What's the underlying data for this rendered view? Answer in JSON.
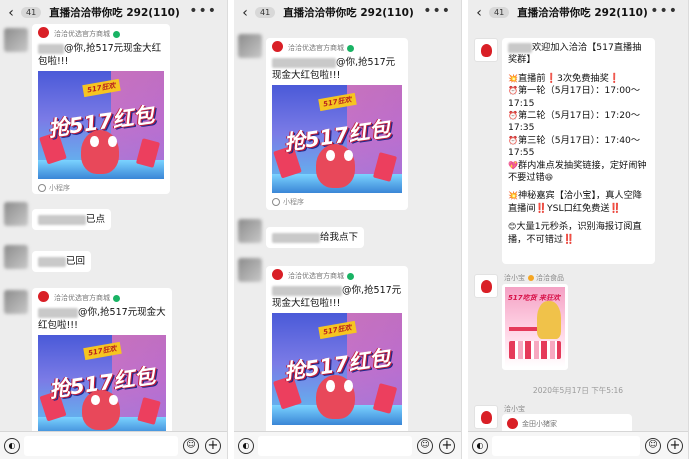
{
  "header": {
    "badge": "41",
    "title": "直播洽洽带你吃 292(110)",
    "back_glyph": "‹",
    "more_glyph": "•••"
  },
  "input_bar": {
    "voice_glyph": "◐",
    "emoji_glyph": "☺",
    "plus_glyph": "+"
  },
  "card_common": {
    "source_name": "洽洽优选官方商城",
    "mini_program_label": "小程序"
  },
  "panel1": {
    "card1_text": "@你,抢517元现金大红包啦!!!",
    "poster_tag": "517狂欢",
    "poster_big": "抢517红包",
    "msg1": "已点",
    "msg2": "已回",
    "card2_text": "@你,抢517元现金大红包啦!!!"
  },
  "panel2": {
    "card1_text": "@你,抢517元现金大红包啦!!!",
    "poster_tag": "517狂欢",
    "poster_big": "抢517红包",
    "msg1": "给我点下",
    "card2_text": "@你,抢517元现金大红包啦!!!"
  },
  "panel3": {
    "announcement": {
      "line1": "欢迎加入洽洽【517直播抽奖群】",
      "line2": "直播前❗3次免费抽奖❗",
      "line3": "第一轮（5月17日）：17:00～17:15",
      "line4": "第二轮（5月17日）：17:20～17:35",
      "line5": "第三轮（5月17日）：17:40～17:55",
      "line6": "群内准点发抽奖链接，定好闹钟不要过错",
      "line7": "神秘嘉宾【洽小宝】，真人空降直播间‼️YSL口红免费送‼️",
      "line8": "大量1元秒杀，识别海报订阅直播，不可错过‼️"
    },
    "sender_name": "洽小宝",
    "sender_tag": "洽洽食品",
    "poster_banner": "517吃货 来狂欢",
    "timestamp": "2020年5月17日 下午5:16",
    "sender2_name": "洽小宝",
    "cut_card_source": "金田小猪家"
  },
  "colors": {
    "chat_bg": "#ededed",
    "bubble_bg": "#ffffff",
    "brand_red": "#d91f26",
    "verify_green": "#19b364"
  }
}
